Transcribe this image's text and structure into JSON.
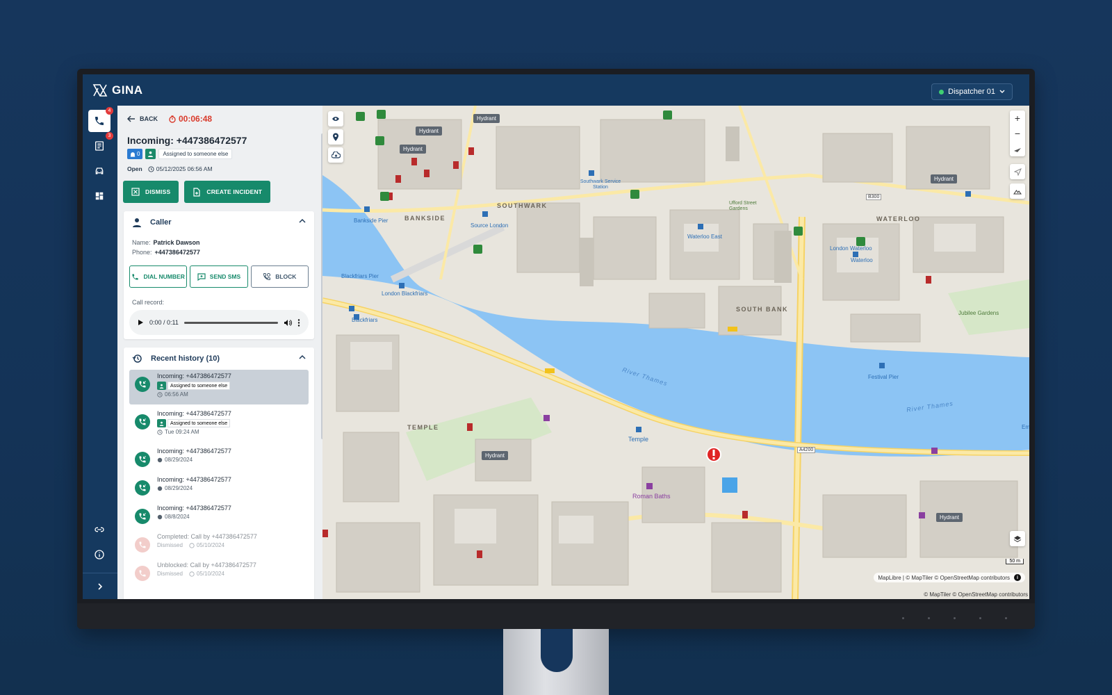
{
  "app": {
    "name": "GINA"
  },
  "dispatcher": {
    "label": "Dispatcher 01",
    "status_color": "#3fcf72"
  },
  "nav": {
    "calls_badge": "4",
    "list_badge": "3"
  },
  "call": {
    "back_label": "BACK",
    "timer": "00:06:48",
    "title": "Incoming: +447386472577",
    "tag_count": "0",
    "assigned": "Assigned to someone else",
    "status": "Open",
    "datetime": "05/12/2025 06:56 AM",
    "dismiss_label": "DISMISS",
    "create_incident_label": "CREATE INCIDENT"
  },
  "caller": {
    "header": "Caller",
    "name_key": "Name:",
    "name": "Patrick Dawson",
    "phone_key": "Phone:",
    "phone": "+447386472577",
    "dial_label": "DIAL NUMBER",
    "sms_label": "SEND SMS",
    "block_label": "BLOCK",
    "record_label": "Call record:",
    "audio_time": "0:00 / 0:11"
  },
  "history": {
    "header": "Recent history (10)",
    "items": [
      {
        "title": "Incoming: +447386472577",
        "tag": "Assigned to someone else",
        "time": "06:56 AM"
      },
      {
        "title": "Incoming: +447386472577",
        "tag": "Assigned to someone else",
        "time": "Tue 09:24 AM"
      },
      {
        "title": "Incoming: +447386472577",
        "time": "08/29/2024"
      },
      {
        "title": "Incoming: +447386472577",
        "time": "08/29/2024"
      },
      {
        "title": "Incoming: +447386472577",
        "time": "08/8/2024"
      },
      {
        "title": "Completed: Call by +447386472577",
        "status": "Dismissed",
        "time": "05/10/2024"
      },
      {
        "title": "Unblocked: Call by +447386472577",
        "status": "Dismissed",
        "time": "05/10/2024"
      }
    ]
  },
  "map": {
    "labels": {
      "southwark": "SOUTHWARK",
      "bankside": "BANKSIDE",
      "waterloo": "WATERLOO",
      "south_bank": "SOUTH BANK",
      "temple": "TEMPLE",
      "river1": "River Thames",
      "river2": "River Thames",
      "roman_baths": "Roman Baths",
      "temple_stn": "Temple",
      "festival_pier": "Festival Pier",
      "blackfriars_pier": "Blackfriars Pier",
      "london_blackfriars": "London Blackfriars",
      "blackfriars": "Blackfriars",
      "bankside_pier": "Bankside Pier",
      "source_london": "Source London",
      "waterloo_east": "Waterloo East",
      "london_waterloo": "London Waterloo",
      "waterloo_stn": "Waterloo",
      "jubilee_gardens": "Jubilee Gardens",
      "a4200": "A4200",
      "b300": "B300",
      "southwark_station": "Southwark Service Station",
      "ufford": "Ufford Street Gardens",
      "em": "Em"
    },
    "hydrant_label": "Hydrant",
    "scale": "50 m",
    "attribution": "MapLibre | © MapTiler © OpenStreetMap contributors",
    "attribution2": "© MapTiler © OpenStreetMap contributors"
  },
  "colors": {
    "accent": "#178a6b",
    "header": "#15395f",
    "water": "#8cc4f4",
    "alert": "#e02424"
  }
}
